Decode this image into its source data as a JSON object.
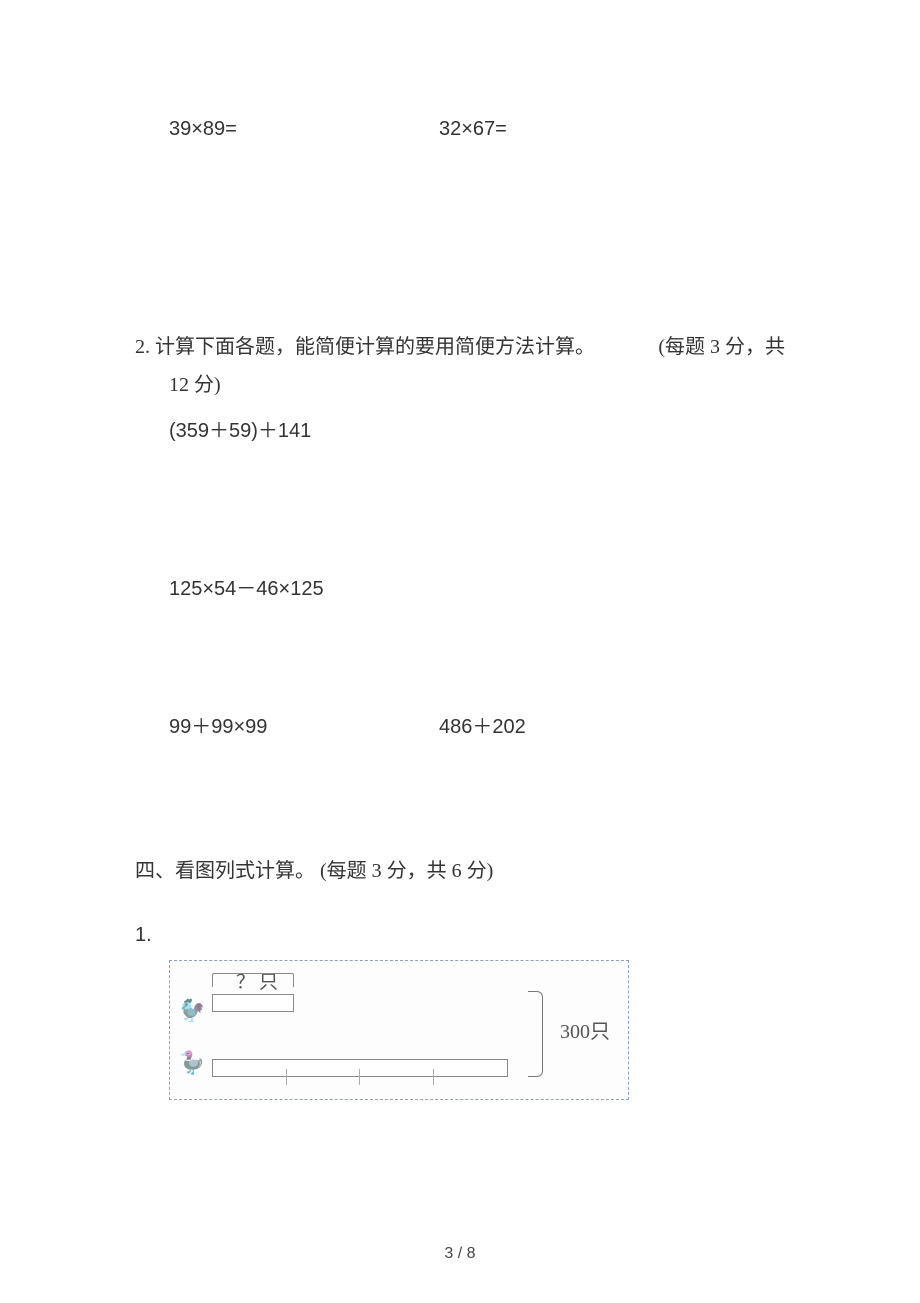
{
  "exercises_row1": {
    "left": "39×89=",
    "right": "32×67="
  },
  "section2": {
    "num": "2.",
    "title_a": "计算下面各题，能简便计算的要用简便方法计算。",
    "score": "(每题 3 分，共",
    "score_line2": "12 分)",
    "expr1": "(359＋59)＋141",
    "expr2": "125×54－46×125",
    "expr3_left": "99＋99×99",
    "expr3_right": "486＋202"
  },
  "section4": {
    "heading": "四、看图列式计算。 (每题 3 分，共 6 分)",
    "item1_num": "1."
  },
  "figure": {
    "q_label": "？只",
    "total_label": "300只"
  },
  "footer": "3 / 8"
}
